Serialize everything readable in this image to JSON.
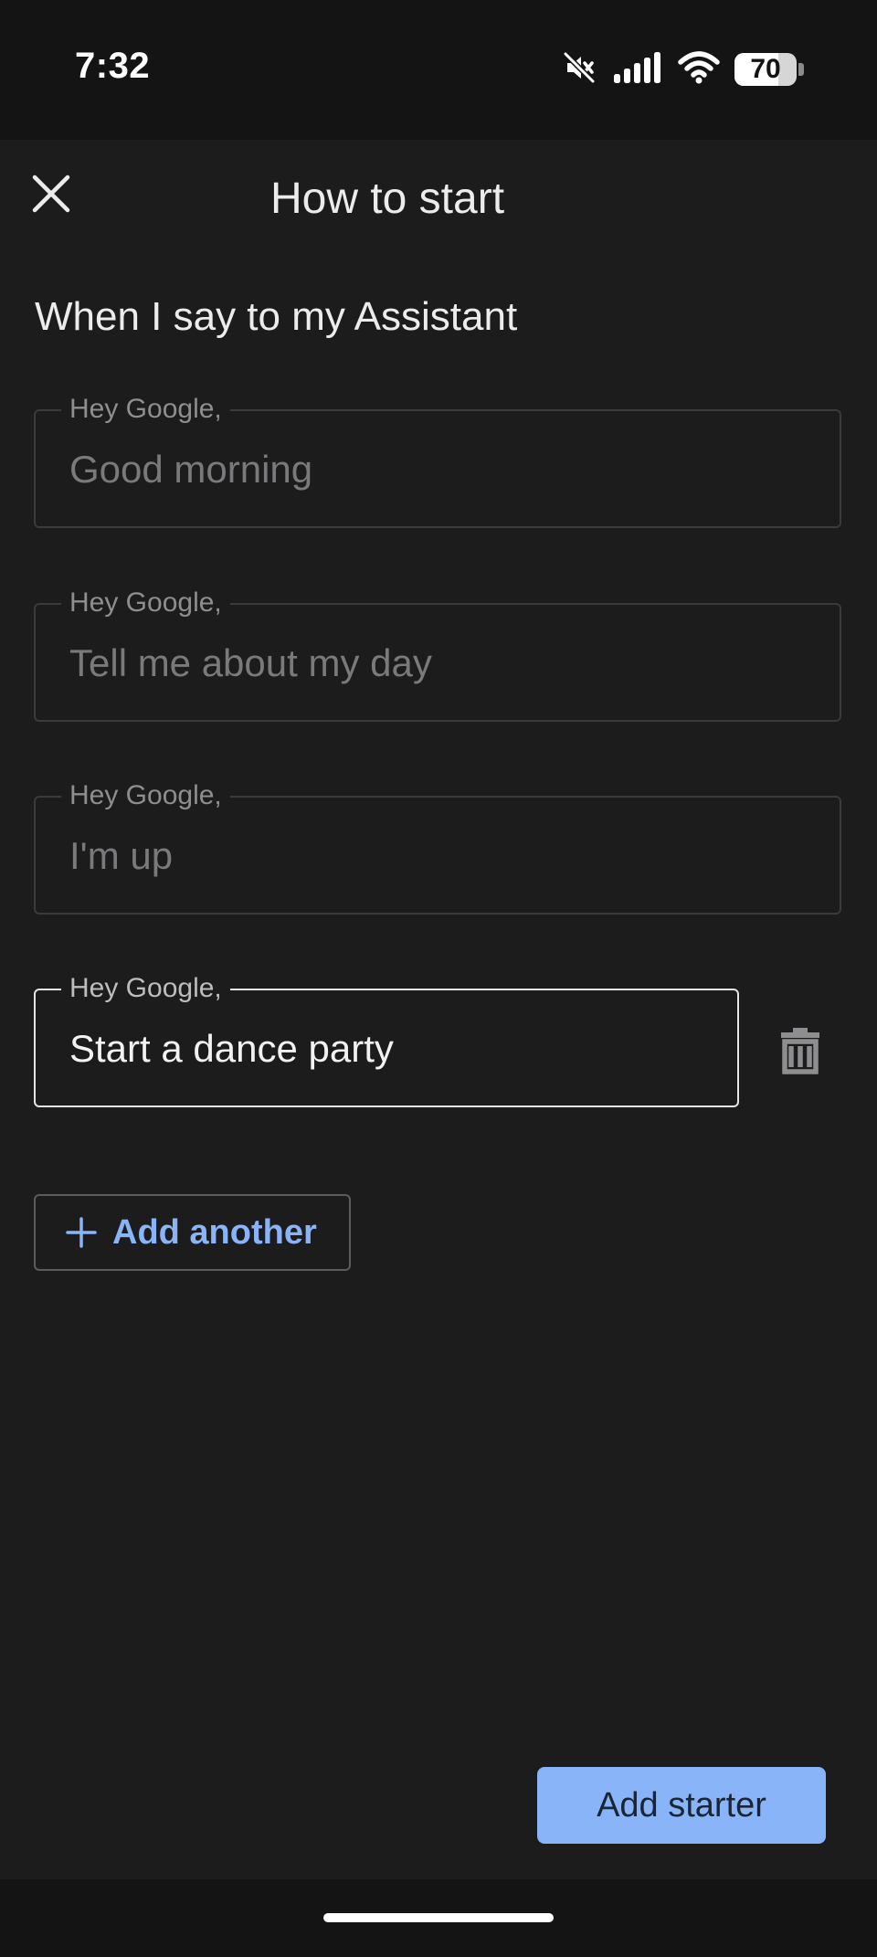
{
  "status_bar": {
    "time": "7:32",
    "battery_level": "70",
    "icons": [
      "mute-icon",
      "signal-icon",
      "wifi-icon",
      "battery-icon"
    ]
  },
  "header": {
    "title": "How to start",
    "close_icon": "close-icon"
  },
  "section": {
    "label": "When I say to my Assistant"
  },
  "starters": [
    {
      "prefix": "Hey Google,",
      "value": "Good morning",
      "state": "placeholder"
    },
    {
      "prefix": "Hey Google,",
      "value": "Tell me about my day",
      "state": "placeholder"
    },
    {
      "prefix": "Hey Google,",
      "value": "I'm up",
      "state": "placeholder"
    },
    {
      "prefix": "Hey Google,",
      "value": "Start a dance party",
      "state": "filled"
    }
  ],
  "delete_icon": "trash-icon",
  "add_another": {
    "label": "Add another",
    "icon": "plus-icon"
  },
  "primary_action": {
    "label": "Add starter"
  },
  "colors": {
    "background": "#1c1c1d",
    "accent": "#8ab4f8",
    "status_bar": "#141414"
  }
}
